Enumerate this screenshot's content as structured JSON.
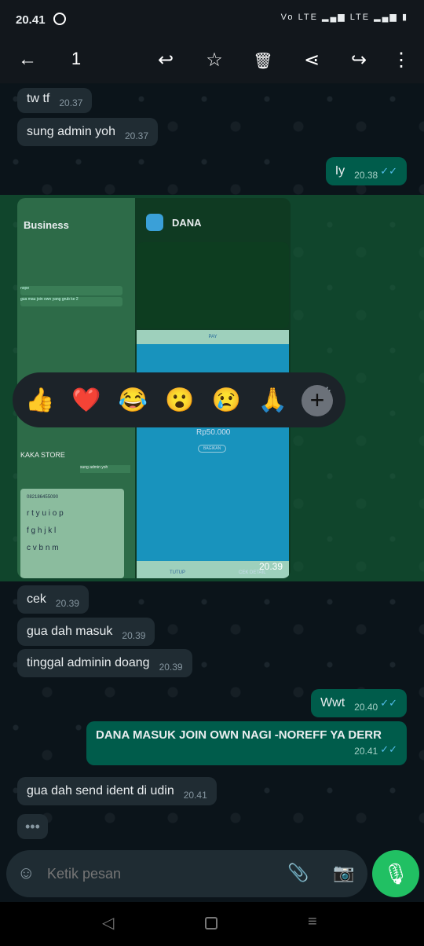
{
  "status_bar": {
    "time": "20.41",
    "indicators": "Vo LTE ▂▄▆ LTE ▂▄▆ ▮"
  },
  "toolbar": {
    "back_icon": "arrow-left",
    "selected_count": "1",
    "actions": [
      "reply",
      "star",
      "delete",
      "share",
      "forward",
      "more"
    ]
  },
  "messages": [
    {
      "dir": "in",
      "text": "tw tf",
      "time": "20.37"
    },
    {
      "dir": "in",
      "text": "sung admin yoh",
      "time": "20.37"
    },
    {
      "dir": "out",
      "text": "Iy",
      "time": "20.38",
      "read": true
    },
    {
      "dir": "in",
      "type": "image",
      "time": "20.39",
      "image": {
        "left_title": "Business",
        "right_title": "DANA",
        "amount": "Rp50.000",
        "share": "BAGIKAN",
        "pay": "PAY",
        "btn_close": "TUTUP",
        "btn_detail": "CEK DETAIL",
        "store": "KAKA STORE",
        "chat1": "gua mau join own yang grub ke 2",
        "chat2": "sung admin yoh",
        "chat3": "tw tf",
        "chat4": "nope",
        "phone": "082186455090",
        "keys": [
          "r",
          "t",
          "y",
          "u",
          "i",
          "o",
          "p",
          "f",
          "g",
          "h",
          "j",
          "k",
          "l",
          "c",
          "v",
          "b",
          "n",
          "m"
        ]
      }
    },
    {
      "dir": "in",
      "text": "cek",
      "time": "20.39"
    },
    {
      "dir": "in",
      "text": "gua dah masuk",
      "time": "20.39"
    },
    {
      "dir": "in",
      "text": "tinggal adminin doang",
      "time": "20.39"
    },
    {
      "dir": "out",
      "text": "Wwt",
      "time": "20.40",
      "read": true
    },
    {
      "dir": "out",
      "text": "DANA MASUK JOIN OWN NAGI -NOREFF YA DERR",
      "time": "20.41",
      "read": true
    },
    {
      "dir": "in",
      "text": "gua dah send ident di udin",
      "time": "20.41"
    }
  ],
  "typing_indicator": "•••",
  "reactions": [
    "👍",
    "❤️",
    "😂",
    "😮",
    "😢",
    "🙏",
    "👏"
  ],
  "reaction_more": "+",
  "composer": {
    "placeholder": "Ketik pesan"
  },
  "colors": {
    "incoming": "#202c33",
    "outgoing": "#005c4b",
    "accent": "#21c063",
    "read_ticks": "#53bdeb"
  }
}
